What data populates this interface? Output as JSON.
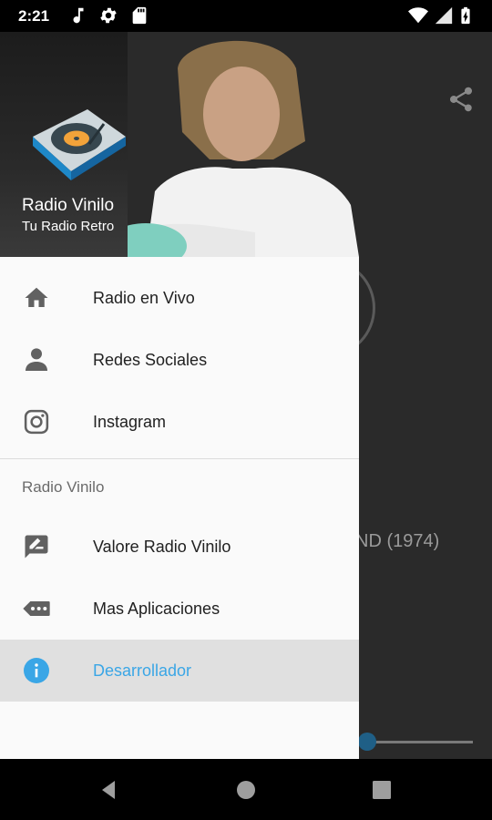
{
  "status_bar": {
    "time": "2:21"
  },
  "background": {
    "song_text": "ND (1974)"
  },
  "header": {
    "title": "Radio Vinilo",
    "subtitle": "Tu Radio Retro"
  },
  "menu": {
    "items": [
      {
        "label": "Radio en Vivo",
        "icon": "home-icon"
      },
      {
        "label": "Redes Sociales",
        "icon": "person-icon"
      },
      {
        "label": "Instagram",
        "icon": "instagram-icon"
      }
    ],
    "section_title": "Radio Vinilo",
    "section_items": [
      {
        "label": "Valore Radio Vinilo",
        "icon": "rate-review-icon"
      },
      {
        "label": "Mas Aplicaciones",
        "icon": "more-apps-icon"
      },
      {
        "label": "Desarrollador",
        "icon": "info-icon",
        "active": true
      }
    ]
  },
  "colors": {
    "accent": "#3aa6e6",
    "active_bg": "#e0e0e0",
    "drawer_bg": "#fafafa"
  }
}
